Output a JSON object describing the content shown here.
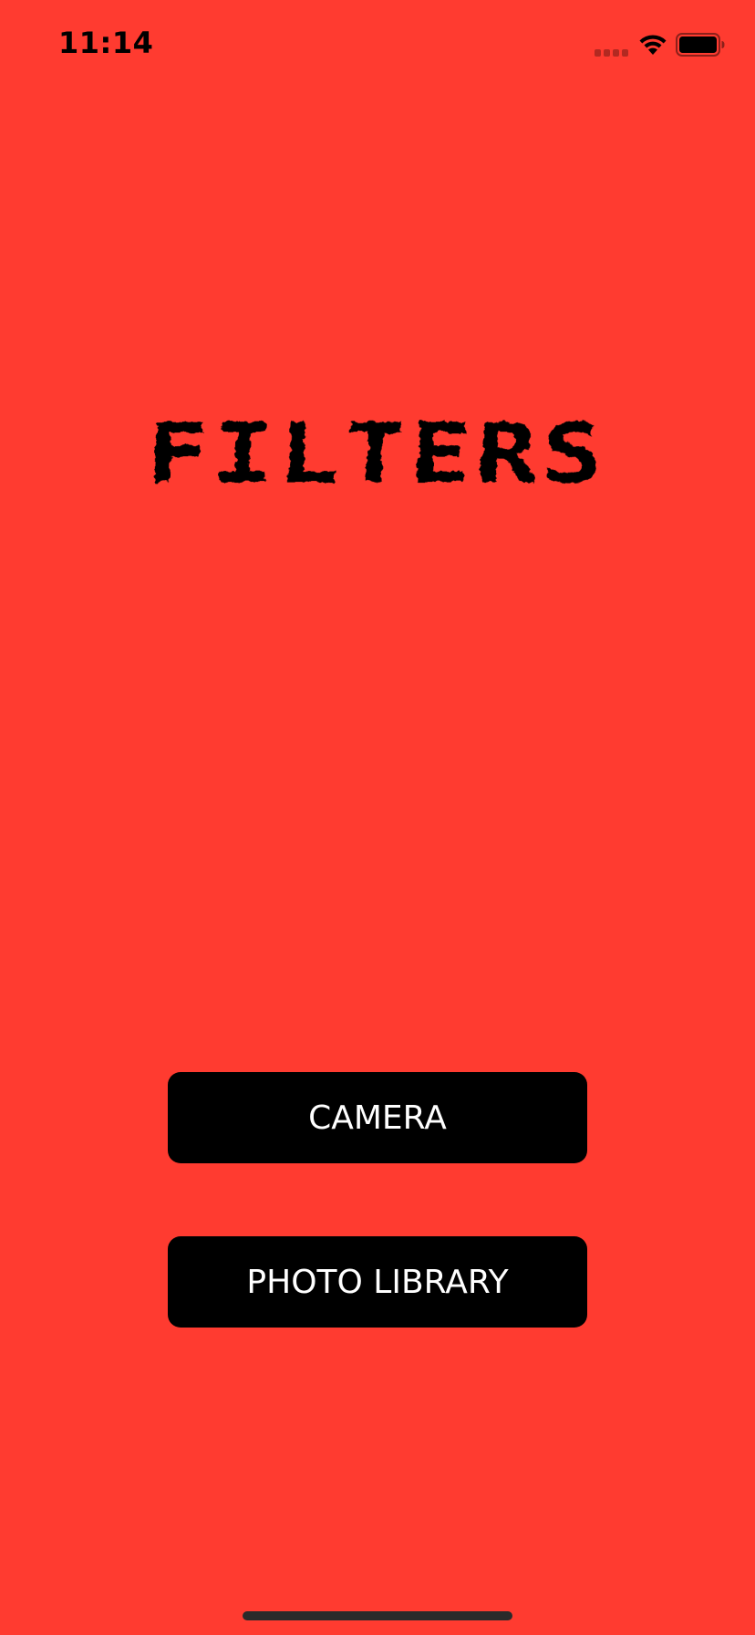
{
  "status_bar": {
    "time": "11:14",
    "icons": [
      "signal-icon",
      "wifi-icon",
      "battery-icon"
    ],
    "battery_level": 1.0
  },
  "main": {
    "title": "FILTERS",
    "buttons": [
      {
        "label": "CAMERA",
        "icon": null
      },
      {
        "label": "PHOTO LIBRARY",
        "icon": null
      }
    ]
  },
  "colors": {
    "background": "#FF3B30",
    "button_background": "#000000",
    "button_text": "#FFFFFF",
    "title_text": "#000000"
  }
}
